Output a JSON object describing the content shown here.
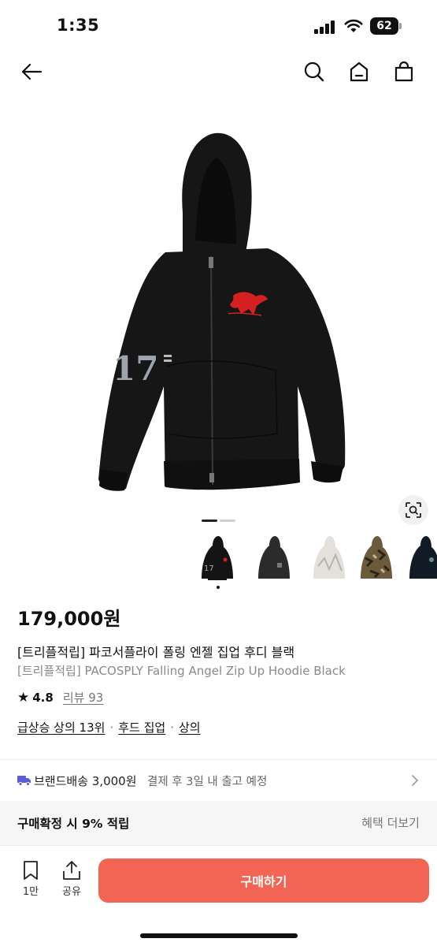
{
  "status_bar": {
    "time": "1:35",
    "battery": "62"
  },
  "product": {
    "price": "179,000원",
    "title_ko": "[트리플적립] 파코서플라이 폴링 엔젤 집업 후디 블랙",
    "title_en": "[트리플적립] PACOSPLY Falling Angel Zip Up Hoodie Black",
    "image_print_number": "17",
    "rating": "4.8",
    "reviews_label": "리뷰 93",
    "tags": [
      "급상승 상의 13위",
      "후드 집업",
      "상의"
    ],
    "tag_separator": "·"
  },
  "shipping": {
    "label": "브랜드배송 3,000원",
    "desc": "결제 후 3일 내 출고 예정"
  },
  "reward": {
    "label": "구매확정 시 9% 적립",
    "more": "혜택 더보기"
  },
  "bottom_bar": {
    "bookmark_count": "1만",
    "share_label": "공유",
    "buy_label": "구매하기"
  },
  "colors": {
    "accent": "#f26554",
    "text": "#111111",
    "muted": "#777777"
  },
  "icons": [
    "back-arrow-icon",
    "search-icon",
    "home-icon",
    "shopping-bag-icon",
    "lens-search-icon",
    "truck-icon",
    "chevron-right-icon",
    "bookmark-icon",
    "share-icon"
  ]
}
